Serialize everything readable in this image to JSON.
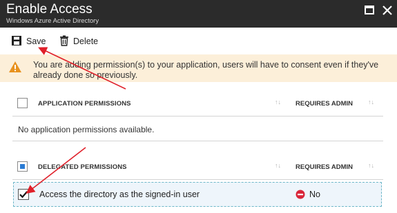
{
  "window": {
    "title": "Enable Access",
    "subtitle": "Windows Azure Active Directory",
    "maximize_icon": "maximize-icon",
    "close_icon": "close-icon"
  },
  "toolbar": {
    "save_label": "Save",
    "save_icon": "floppy-disk-icon",
    "delete_label": "Delete",
    "delete_icon": "trash-icon"
  },
  "warning": {
    "text": "You are adding permission(s) to your application, users will have to consent even if they've already done so previously.",
    "icon": "warning-triangle-icon",
    "background": "#fcefd9"
  },
  "application_permissions": {
    "header": "APPLICATION PERMISSIONS",
    "admin_header": "REQUIRES ADMIN",
    "empty_text": "No application permissions available."
  },
  "delegated_permissions": {
    "header": "DELEGATED PERMISSIONS",
    "admin_header": "REQUIRES ADMIN",
    "rows": [
      {
        "label": "Access the directory as the signed-in user",
        "checked": true,
        "requires_admin": "No"
      }
    ]
  },
  "colors": {
    "titlebar": "#2b2b2b",
    "accent_blue": "#2a7bd4",
    "no_icon_red": "#d9263a",
    "annotation_arrow": "#e0202a"
  }
}
